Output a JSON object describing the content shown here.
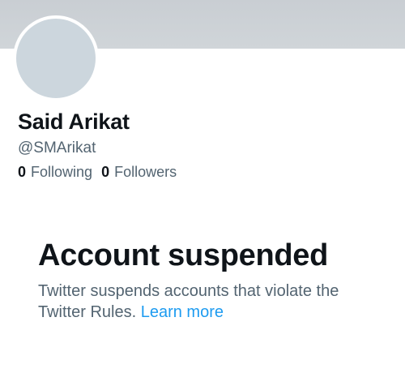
{
  "profile": {
    "display_name": "Said Arikat",
    "handle": "@SMArikat",
    "following_count": "0",
    "following_label": "Following",
    "followers_count": "0",
    "followers_label": "Followers"
  },
  "suspension": {
    "title": "Account suspended",
    "message": "Twitter suspends accounts that violate the Twitter Rules.",
    "link_label": "Learn more"
  },
  "colors": {
    "banner": "#c9ced3",
    "avatar_placeholder": "#ccd6dd",
    "primary_text": "#0f1419",
    "secondary_text": "#536471",
    "link": "#1d9bf0"
  }
}
